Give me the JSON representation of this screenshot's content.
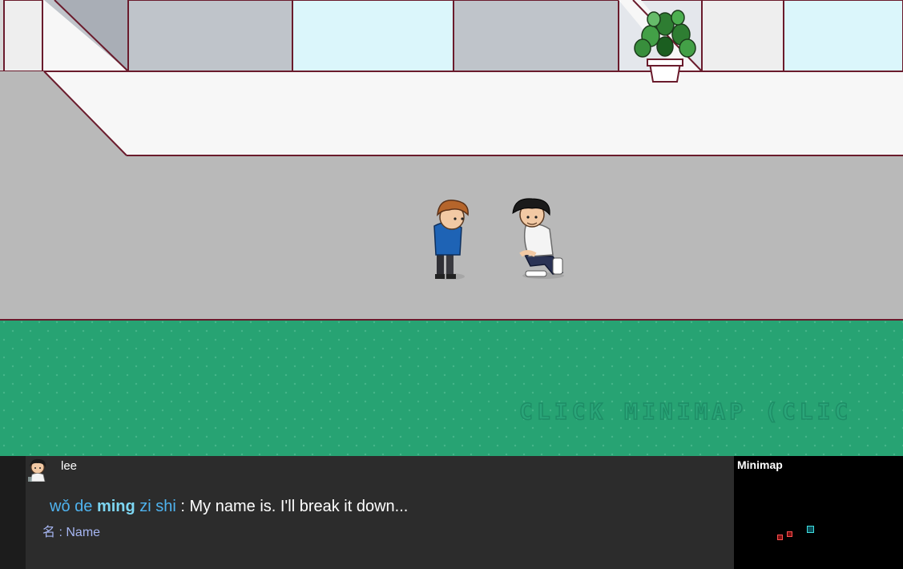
{
  "scene": {
    "scroll_banner_text": "CLICK MINIMAP (CLIC",
    "colors": {
      "grass": "#27a373",
      "floor": "#b9b9b9",
      "wall": "#f7f7f7",
      "window_blue": "#dbf6fb",
      "window_gray": "#bfc4ca",
      "outline": "#6a1b2c"
    }
  },
  "characters": [
    {
      "name": "boy-blue-hoodie"
    },
    {
      "name": "lee"
    }
  ],
  "dialog": {
    "speaker": "lee",
    "pinyin": [
      {
        "text": "wǒ de ",
        "style": "normal"
      },
      {
        "text": "ming",
        "style": "strong"
      },
      {
        "text": " zi shi",
        "style": "normal"
      }
    ],
    "separator": " : ",
    "translation": "My name is. I'll break it down...",
    "vocab": {
      "hanzi": "名",
      "separator": " : ",
      "meaning": "Name"
    }
  },
  "minimap": {
    "title": "Minimap"
  }
}
